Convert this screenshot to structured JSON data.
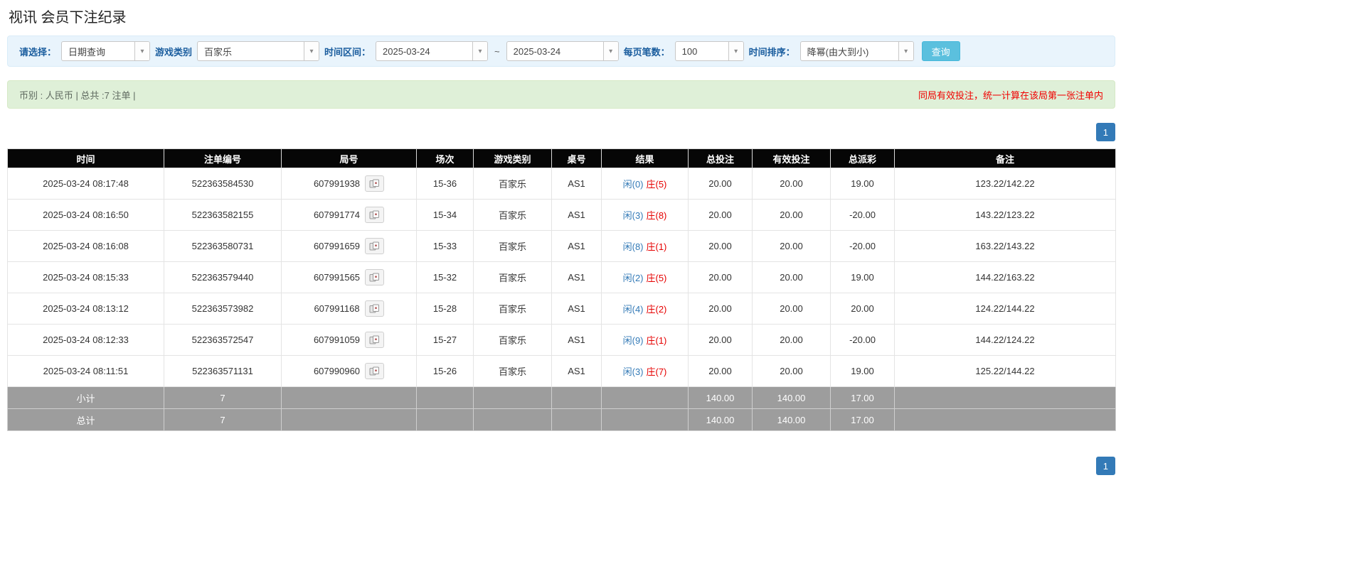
{
  "page": {
    "title": "视讯 会员下注纪录"
  },
  "icons": {
    "chevron_down": "▾"
  },
  "colors": {
    "accent_blue": "#337ab7",
    "search_button_teal": "#5bc0de",
    "player_blue": "#337ab7",
    "banker_red": "#e60000",
    "negative_red": "#ff0000",
    "table_header_bg": "#060606",
    "table_footer_bg": "#9d9d9d",
    "filter_bar_bg": "#e9f4fc",
    "summary_bar_bg": "#dff0d8"
  },
  "filters": {
    "select_label": "请选择：",
    "select_value": "日期查询",
    "game_label": "游戏类别",
    "game_value": "百家乐",
    "range_label": "时间区间：",
    "date_from": "2025-03-24",
    "range_separator": "~",
    "date_to": "2025-03-24",
    "page_size_label": "每页笔数：",
    "page_size_value": "100",
    "sort_label": "时间排序：",
    "sort_value": "降幂(由大到小)",
    "search_button": "查询"
  },
  "summary": {
    "info": "币别 : 人民币 | 总共 :7 注单 |",
    "notice": "同局有效投注，统一计算在该局第一张注单内"
  },
  "pagination": {
    "page": "1"
  },
  "table": {
    "headers": [
      "时间",
      "注单编号",
      "局号",
      "场次",
      "游戏类别",
      "桌号",
      "结果",
      "总投注",
      "有效投注",
      "总派彩",
      "备注"
    ],
    "rows": [
      {
        "time": "2025-03-24 08:17:48",
        "bet_id": "522363584530",
        "round_id": "607991938",
        "session": "15-36",
        "game": "百家乐",
        "table_no": "AS1",
        "result_player": "闲(0)",
        "result_banker": "庄(5)",
        "total_bet": "20.00",
        "valid_bet": "20.00",
        "payout": "19.00",
        "remark": "123.22/142.22"
      },
      {
        "time": "2025-03-24 08:16:50",
        "bet_id": "522363582155",
        "round_id": "607991774",
        "session": "15-34",
        "game": "百家乐",
        "table_no": "AS1",
        "result_player": "闲(3)",
        "result_banker": "庄(8)",
        "total_bet": "20.00",
        "valid_bet": "20.00",
        "payout": "-20.00",
        "remark": "143.22/123.22"
      },
      {
        "time": "2025-03-24 08:16:08",
        "bet_id": "522363580731",
        "round_id": "607991659",
        "session": "15-33",
        "game": "百家乐",
        "table_no": "AS1",
        "result_player": "闲(8)",
        "result_banker": "庄(1)",
        "total_bet": "20.00",
        "valid_bet": "20.00",
        "payout": "-20.00",
        "remark": "163.22/143.22"
      },
      {
        "time": "2025-03-24 08:15:33",
        "bet_id": "522363579440",
        "round_id": "607991565",
        "session": "15-32",
        "game": "百家乐",
        "table_no": "AS1",
        "result_player": "闲(2)",
        "result_banker": "庄(5)",
        "total_bet": "20.00",
        "valid_bet": "20.00",
        "payout": "19.00",
        "remark": "144.22/163.22"
      },
      {
        "time": "2025-03-24 08:13:12",
        "bet_id": "522363573982",
        "round_id": "607991168",
        "session": "15-28",
        "game": "百家乐",
        "table_no": "AS1",
        "result_player": "闲(4)",
        "result_banker": "庄(2)",
        "total_bet": "20.00",
        "valid_bet": "20.00",
        "payout": "20.00",
        "remark": "124.22/144.22"
      },
      {
        "time": "2025-03-24 08:12:33",
        "bet_id": "522363572547",
        "round_id": "607991059",
        "session": "15-27",
        "game": "百家乐",
        "table_no": "AS1",
        "result_player": "闲(9)",
        "result_banker": "庄(1)",
        "total_bet": "20.00",
        "valid_bet": "20.00",
        "payout": "-20.00",
        "remark": "144.22/124.22"
      },
      {
        "time": "2025-03-24 08:11:51",
        "bet_id": "522363571131",
        "round_id": "607990960",
        "session": "15-26",
        "game": "百家乐",
        "table_no": "AS1",
        "result_player": "闲(3)",
        "result_banker": "庄(7)",
        "total_bet": "20.00",
        "valid_bet": "20.00",
        "payout": "19.00",
        "remark": "125.22/144.22"
      }
    ],
    "subtotal": {
      "label": "小计",
      "count": "7",
      "total_bet": "140.00",
      "valid_bet": "140.00",
      "payout": "17.00"
    },
    "total": {
      "label": "总计",
      "count": "7",
      "total_bet": "140.00",
      "valid_bet": "140.00",
      "payout": "17.00"
    }
  }
}
